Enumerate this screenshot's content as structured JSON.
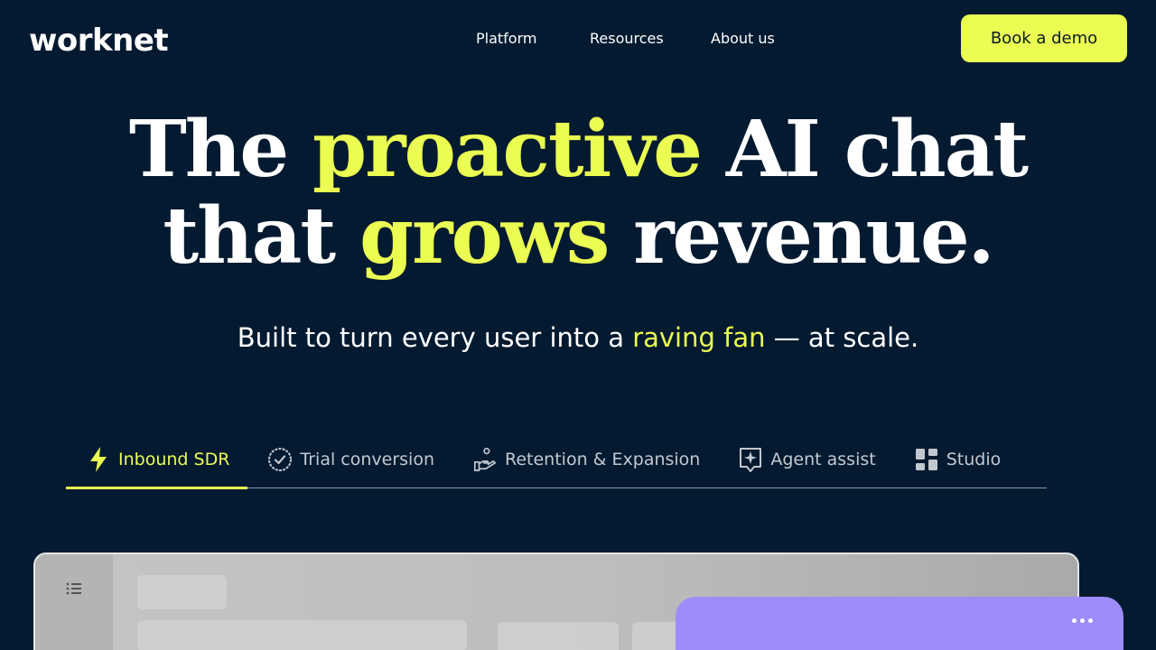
{
  "header": {
    "logo": "worknet",
    "nav": [
      "Platform",
      "Resources",
      "About us"
    ],
    "cta": "Book a demo"
  },
  "hero": {
    "line1": {
      "pre": "The ",
      "accent": "proactive",
      "post": " AI chat"
    },
    "line2": {
      "pre": "that ",
      "accent": "grows",
      "post": " revenue."
    },
    "subtitle": {
      "pre": "Built to turn every user into a ",
      "accent": "raving fan",
      "post": " — at scale."
    }
  },
  "tabs": [
    {
      "label": "Inbound SDR",
      "icon": "lightning-icon",
      "active": true
    },
    {
      "label": "Trial conversion",
      "icon": "check-badge-icon",
      "active": false
    },
    {
      "label": "Retention & Expansion",
      "icon": "hand-coin-icon",
      "active": false
    },
    {
      "label": "Agent assist",
      "icon": "sparkle-chat-icon",
      "active": false
    },
    {
      "label": "Studio",
      "icon": "grid-icon",
      "active": false
    }
  ],
  "colors": {
    "background": "#041a30",
    "accent": "#ebfc52",
    "chat_panel": "#9e8cf8"
  }
}
